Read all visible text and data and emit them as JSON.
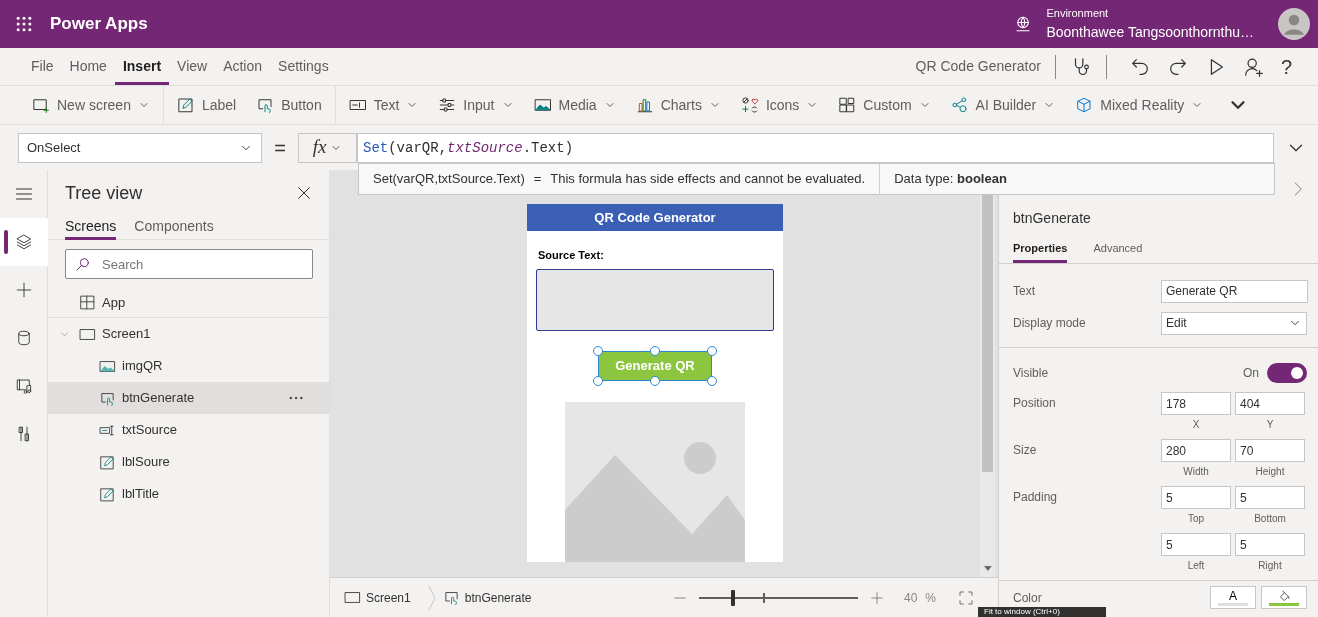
{
  "app_bar": {
    "title": "Power Apps",
    "environment_label": "Environment",
    "environment_name": "Boonthawee Tangsoonthornthu…"
  },
  "menu": {
    "tabs": [
      {
        "label": "File",
        "selected": false
      },
      {
        "label": "Home",
        "selected": false
      },
      {
        "label": "Insert",
        "selected": true
      },
      {
        "label": "View",
        "selected": false
      },
      {
        "label": "Action",
        "selected": false
      },
      {
        "label": "Settings",
        "selected": false
      }
    ],
    "app_name": "QR Code Generator",
    "help": "?"
  },
  "ribbon": {
    "groups": [
      [
        {
          "label": "New screen",
          "kind": "screen",
          "dropdown": true
        }
      ],
      [
        {
          "label": "Label",
          "kind": "label",
          "dropdown": false
        },
        {
          "label": "Button",
          "kind": "button",
          "dropdown": false
        }
      ],
      [
        {
          "label": "Text",
          "kind": "text",
          "dropdown": true
        },
        {
          "label": "Input",
          "kind": "input",
          "dropdown": true
        },
        {
          "label": "Media",
          "kind": "media",
          "dropdown": true
        },
        {
          "label": "Charts",
          "kind": "charts",
          "dropdown": true
        },
        {
          "label": "Icons",
          "kind": "icons",
          "dropdown": true
        },
        {
          "label": "Custom",
          "kind": "custom",
          "dropdown": true
        },
        {
          "label": "AI Builder",
          "kind": "ai",
          "dropdown": true
        },
        {
          "label": "Mixed Reality",
          "kind": "mixed",
          "dropdown": true
        }
      ]
    ]
  },
  "formula_bar": {
    "property": "OnSelect",
    "equals": "=",
    "fx": "fx",
    "formula": [
      {
        "text": "Set",
        "kind": "function"
      },
      {
        "text": "(varQR,",
        "kind": "plain"
      },
      {
        "text": "txtSource",
        "kind": "control"
      },
      {
        "text": ".Text)",
        "kind": "plain"
      }
    ]
  },
  "formula_tooltip": {
    "expression": "Set(varQR,txtSource.Text)",
    "equals": "=",
    "message": "This formula has side effects and cannot be evaluated.",
    "data_type": "Data type: **boolean**"
  },
  "rail": [
    {
      "kind": "tree",
      "selected": true
    },
    {
      "kind": "insert",
      "selected": false
    },
    {
      "kind": "data",
      "selected": false
    },
    {
      "kind": "media",
      "selected": false
    },
    {
      "kind": "tools",
      "selected": false
    }
  ],
  "tree_view": {
    "title": "Tree view",
    "tabs": [
      {
        "label": "Screens",
        "selected": true
      },
      {
        "label": "Components",
        "selected": false
      }
    ],
    "search": {
      "placeholder": "Search"
    },
    "items": [
      {
        "label": "App",
        "kind": "app",
        "selected": false
      },
      {
        "label": "Screen1",
        "kind": "screen",
        "selected": false,
        "expanded": true,
        "children": [
          {
            "label": "imgQR",
            "kind": "image",
            "selected": false
          },
          {
            "label": "btnGenerate",
            "kind": "button",
            "selected": true
          },
          {
            "label": "txtSource",
            "kind": "textinput",
            "selected": false
          },
          {
            "label": "lblSoure",
            "kind": "label",
            "selected": false
          },
          {
            "label": "lblTitle",
            "kind": "label",
            "selected": false
          }
        ]
      }
    ]
  },
  "canvas": {
    "title": "QR Code Generator",
    "source_label": "Source Text:",
    "button": "Generate QR"
  },
  "status_bar": {
    "breadcrumb": [
      {
        "label": "Screen1",
        "kind": "screen"
      },
      {
        "label": "btnGenerate",
        "kind": "button"
      }
    ],
    "zoom": {
      "level": 0.2,
      "reading": "40",
      "unit": "%"
    },
    "tooltip": "Fit to window (Ctrl+0)"
  },
  "properties": {
    "control": "btnGenerate",
    "tabs": [
      {
        "label": "Properties",
        "selected": true
      },
      {
        "label": "Advanced",
        "selected": false
      }
    ],
    "groups": [
      [
        {
          "kind": "text",
          "label": "Text",
          "value": "Generate QR"
        },
        {
          "kind": "dropdown",
          "label": "Display mode",
          "value": "Edit"
        }
      ],
      [
        {
          "kind": "toggle",
          "label": "Visible",
          "reading": "On",
          "on": true
        },
        {
          "kind": "pair",
          "label": "Position",
          "fields": [
            {
              "value": "178",
              "caption": "X"
            },
            {
              "value": "404",
              "caption": "Y"
            }
          ]
        },
        {
          "kind": "pair",
          "label": "Size",
          "fields": [
            {
              "value": "280",
              "caption": "Width"
            },
            {
              "value": "70",
              "caption": "Height"
            }
          ]
        },
        {
          "kind": "pair",
          "label": "Padding",
          "fields": [
            {
              "value": "5",
              "caption": "Top"
            },
            {
              "value": "5",
              "caption": "Bottom"
            },
            {
              "value": "5",
              "caption": "Left"
            },
            {
              "value": "5",
              "caption": "Right"
            }
          ]
        }
      ],
      [
        {
          "kind": "color",
          "label": "Color",
          "font_sample": "A"
        }
      ]
    ]
  }
}
